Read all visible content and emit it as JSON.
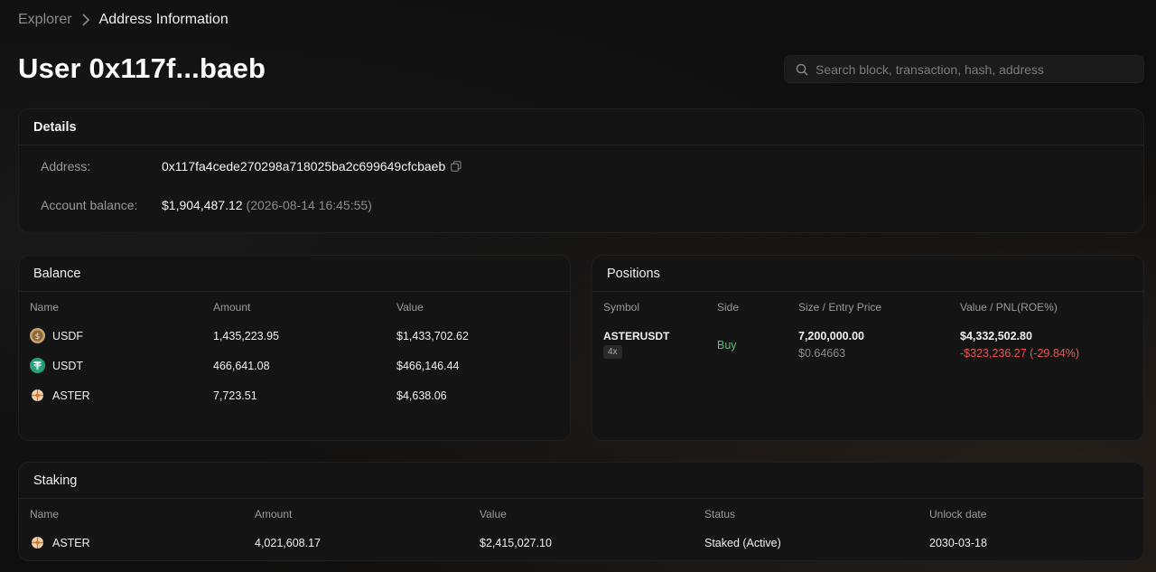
{
  "breadcrumb": {
    "root": "Explorer",
    "current": "Address Information"
  },
  "page_title": "User 0x117f...baeb",
  "search": {
    "placeholder": "Search block, transaction, hash, address"
  },
  "details": {
    "title": "Details",
    "address_label": "Address:",
    "address_value": "0x117fa4cede270298a718025ba2c699649cfcbaeb",
    "balance_label": "Account balance:",
    "balance_value": "$1,904,487.12",
    "balance_timestamp": "(2026-08-14 16:45:55)"
  },
  "balance": {
    "title": "Balance",
    "columns": [
      "Name",
      "Amount",
      "Value"
    ],
    "rows": [
      {
        "name": "USDF",
        "icon": "usdf-coin-icon",
        "amount": "1,435,223.95",
        "value": "$1,433,702.62"
      },
      {
        "name": "USDT",
        "icon": "usdt-coin-icon",
        "amount": "466,641.08",
        "value": "$466,146.44"
      },
      {
        "name": "ASTER",
        "icon": "aster-coin-icon",
        "amount": "7,723.51",
        "value": "$4,638.06"
      }
    ]
  },
  "positions": {
    "title": "Positions",
    "columns": [
      "Symbol",
      "Side",
      "Size / Entry Price",
      "Value / PNL(ROE%)"
    ],
    "rows": [
      {
        "symbol": "ASTERUSDT",
        "leverage": "4x",
        "side": "Buy",
        "size": "7,200,000.00",
        "entry_price": "$0.64663",
        "value": "$4,332,502.80",
        "pnl": "-$323,236.27 (-29.84%)"
      }
    ]
  },
  "staking": {
    "title": "Staking",
    "columns": [
      "Name",
      "Amount",
      "Value",
      "Status",
      "Unlock date"
    ],
    "rows": [
      {
        "name": "ASTER",
        "icon": "aster-coin-icon",
        "amount": "4,021,608.17",
        "value": "$2,415,027.10",
        "status": "Staked (Active)",
        "unlock_date": "2030-03-18"
      }
    ]
  },
  "colors": {
    "background": "#0f0f0f",
    "card": "#141414",
    "buy_green": "#4ec77a",
    "loss_red": "#ef5350",
    "usdf_gold": "#c9a36a",
    "usdt_teal": "#26a17b",
    "aster_orange": "#e9a96b"
  }
}
